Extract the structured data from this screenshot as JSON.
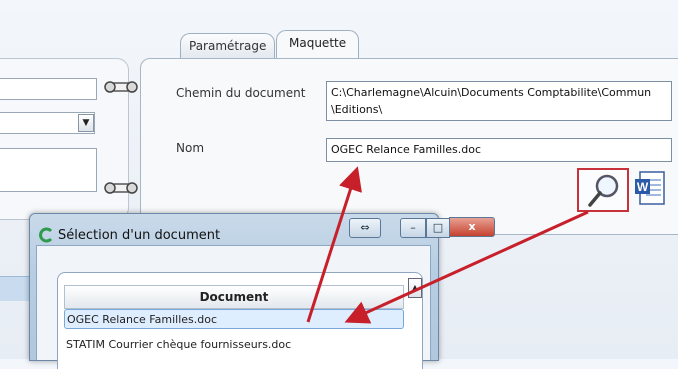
{
  "tabs": [
    {
      "label": "Paramétrage",
      "active": false
    },
    {
      "label": "Maquette",
      "active": true
    }
  ],
  "form": {
    "path_label": "Chemin du document",
    "path_value_line1": "C:\\Charlemagne\\Alcuin\\Documents Comptabilite\\Commun",
    "path_value_line2": "\\Editions\\",
    "name_label": "Nom",
    "name_value": "OGEC Relance Familles.doc"
  },
  "icons": {
    "search": "magnifier-icon",
    "word": "word-document-icon",
    "dialog": "app-logo-icon"
  },
  "dialog": {
    "title": "Sélection d'un document",
    "resize_glyph": "⇔",
    "minimize_glyph": "–",
    "maximize_glyph": "□",
    "close_glyph": "x",
    "column_header": "Document",
    "sort_glyph": "▲",
    "rows": [
      {
        "name": "OGEC Relance Familles.doc",
        "selected": true
      },
      {
        "name": "STATIM Courrier chèque fournisseurs.doc",
        "selected": false
      }
    ]
  },
  "left_panel": {
    "combo_glyph": "▼"
  },
  "colors": {
    "highlight": "#c8303a",
    "arrow": "#c8202a",
    "title_bar": "#b7cde2"
  }
}
